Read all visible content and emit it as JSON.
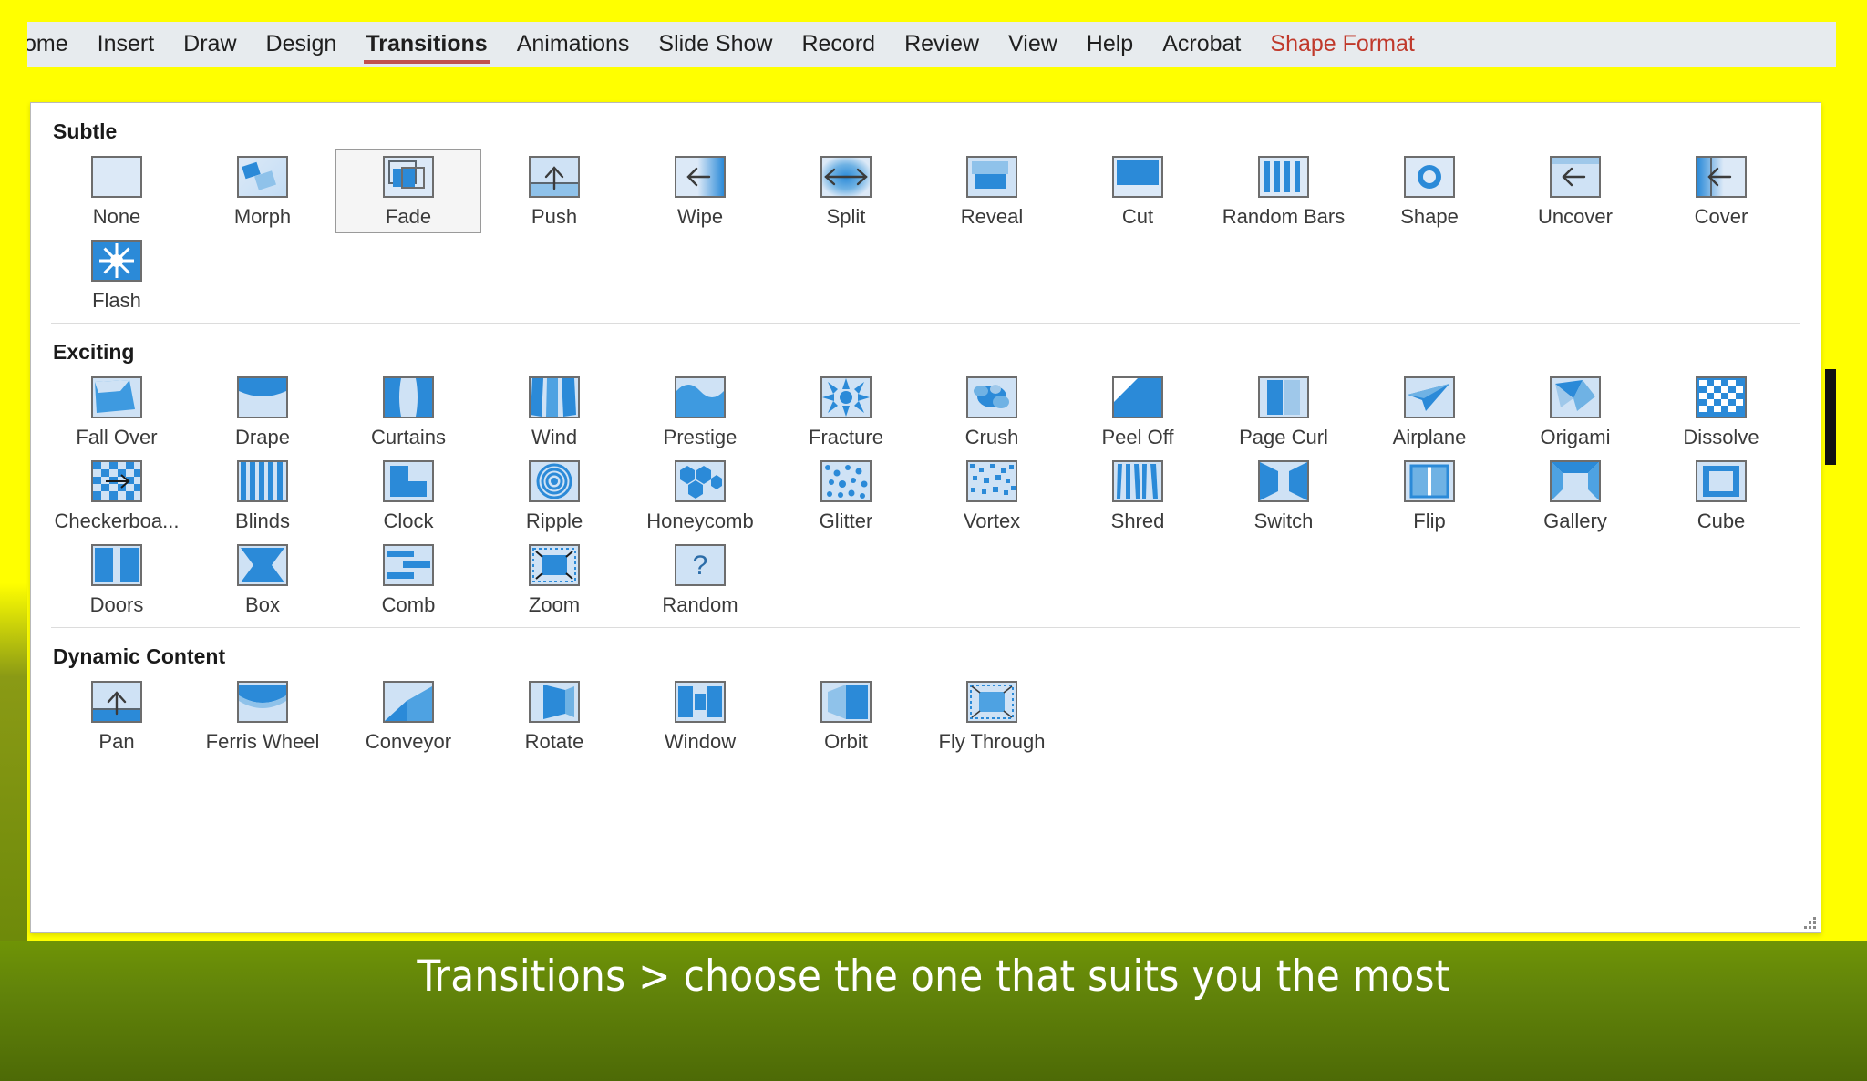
{
  "slide": {
    "background_color": "#FFFF00",
    "caption_band_color": "#62840a",
    "caption": "Transitions > choose the one that suits you the most"
  },
  "ribbon": {
    "accent_color": "#c0504d",
    "contextual_color": "#c0392b",
    "tabs": [
      {
        "label": "ome",
        "active": false,
        "contextual": false
      },
      {
        "label": "Insert",
        "active": false,
        "contextual": false
      },
      {
        "label": "Draw",
        "active": false,
        "contextual": false
      },
      {
        "label": "Design",
        "active": false,
        "contextual": false
      },
      {
        "label": "Transitions",
        "active": true,
        "contextual": false
      },
      {
        "label": "Animations",
        "active": false,
        "contextual": false
      },
      {
        "label": "Slide Show",
        "active": false,
        "contextual": false
      },
      {
        "label": "Record",
        "active": false,
        "contextual": false
      },
      {
        "label": "Review",
        "active": false,
        "contextual": false
      },
      {
        "label": "View",
        "active": false,
        "contextual": false
      },
      {
        "label": "Help",
        "active": false,
        "contextual": false
      },
      {
        "label": "Acrobat",
        "active": false,
        "contextual": false
      },
      {
        "label": "Shape Format",
        "active": false,
        "contextual": true
      }
    ]
  },
  "gallery": {
    "groups": [
      {
        "header": "Subtle",
        "rows": [
          [
            {
              "label": "None",
              "icon": "none-thumb",
              "selected": false
            },
            {
              "label": "Morph",
              "icon": "morph-thumb",
              "selected": false
            },
            {
              "label": "Fade",
              "icon": "fade-thumb",
              "selected": true
            },
            {
              "label": "Push",
              "icon": "push-thumb",
              "selected": false
            },
            {
              "label": "Wipe",
              "icon": "wipe-thumb",
              "selected": false
            },
            {
              "label": "Split",
              "icon": "split-thumb",
              "selected": false
            },
            {
              "label": "Reveal",
              "icon": "reveal-thumb",
              "selected": false
            },
            {
              "label": "Cut",
              "icon": "cut-thumb",
              "selected": false
            },
            {
              "label": "Random Bars",
              "icon": "random-bars-thumb",
              "selected": false
            },
            {
              "label": "Shape",
              "icon": "shape-thumb",
              "selected": false
            },
            {
              "label": "Uncover",
              "icon": "uncover-thumb",
              "selected": false
            },
            {
              "label": "Cover",
              "icon": "cover-thumb",
              "selected": false
            }
          ],
          [
            {
              "label": "Flash",
              "icon": "flash-thumb",
              "selected": false
            }
          ]
        ]
      },
      {
        "header": "Exciting",
        "rows": [
          [
            {
              "label": "Fall Over",
              "icon": "fall-over-thumb",
              "selected": false
            },
            {
              "label": "Drape",
              "icon": "drape-thumb",
              "selected": false
            },
            {
              "label": "Curtains",
              "icon": "curtains-thumb",
              "selected": false
            },
            {
              "label": "Wind",
              "icon": "wind-thumb",
              "selected": false
            },
            {
              "label": "Prestige",
              "icon": "prestige-thumb",
              "selected": false
            },
            {
              "label": "Fracture",
              "icon": "fracture-thumb",
              "selected": false
            },
            {
              "label": "Crush",
              "icon": "crush-thumb",
              "selected": false
            },
            {
              "label": "Peel Off",
              "icon": "peel-off-thumb",
              "selected": false
            },
            {
              "label": "Page Curl",
              "icon": "page-curl-thumb",
              "selected": false
            },
            {
              "label": "Airplane",
              "icon": "airplane-thumb",
              "selected": false
            },
            {
              "label": "Origami",
              "icon": "origami-thumb",
              "selected": false
            },
            {
              "label": "Dissolve",
              "icon": "dissolve-thumb",
              "selected": false
            }
          ],
          [
            {
              "label": "Checkerboa...",
              "icon": "checkerboard-thumb",
              "selected": false
            },
            {
              "label": "Blinds",
              "icon": "blinds-thumb",
              "selected": false
            },
            {
              "label": "Clock",
              "icon": "clock-thumb",
              "selected": false
            },
            {
              "label": "Ripple",
              "icon": "ripple-thumb",
              "selected": false
            },
            {
              "label": "Honeycomb",
              "icon": "honeycomb-thumb",
              "selected": false
            },
            {
              "label": "Glitter",
              "icon": "glitter-thumb",
              "selected": false
            },
            {
              "label": "Vortex",
              "icon": "vortex-thumb",
              "selected": false
            },
            {
              "label": "Shred",
              "icon": "shred-thumb",
              "selected": false
            },
            {
              "label": "Switch",
              "icon": "switch-thumb",
              "selected": false
            },
            {
              "label": "Flip",
              "icon": "flip-thumb",
              "selected": false
            },
            {
              "label": "Gallery",
              "icon": "gallery-thumb",
              "selected": false
            },
            {
              "label": "Cube",
              "icon": "cube-thumb",
              "selected": false
            }
          ],
          [
            {
              "label": "Doors",
              "icon": "doors-thumb",
              "selected": false
            },
            {
              "label": "Box",
              "icon": "box-thumb",
              "selected": false
            },
            {
              "label": "Comb",
              "icon": "comb-thumb",
              "selected": false
            },
            {
              "label": "Zoom",
              "icon": "zoom-thumb",
              "selected": false
            },
            {
              "label": "Random",
              "icon": "random-thumb",
              "selected": false
            }
          ]
        ]
      },
      {
        "header": "Dynamic Content",
        "rows": [
          [
            {
              "label": "Pan",
              "icon": "pan-thumb",
              "selected": false
            },
            {
              "label": "Ferris Wheel",
              "icon": "ferris-wheel-thumb",
              "selected": false
            },
            {
              "label": "Conveyor",
              "icon": "conveyor-thumb",
              "selected": false
            },
            {
              "label": "Rotate",
              "icon": "rotate-thumb",
              "selected": false
            },
            {
              "label": "Window",
              "icon": "window-thumb",
              "selected": false
            },
            {
              "label": "Orbit",
              "icon": "orbit-thumb",
              "selected": false
            },
            {
              "label": "Fly Through",
              "icon": "fly-through-thumb",
              "selected": false
            }
          ]
        ]
      }
    ]
  }
}
